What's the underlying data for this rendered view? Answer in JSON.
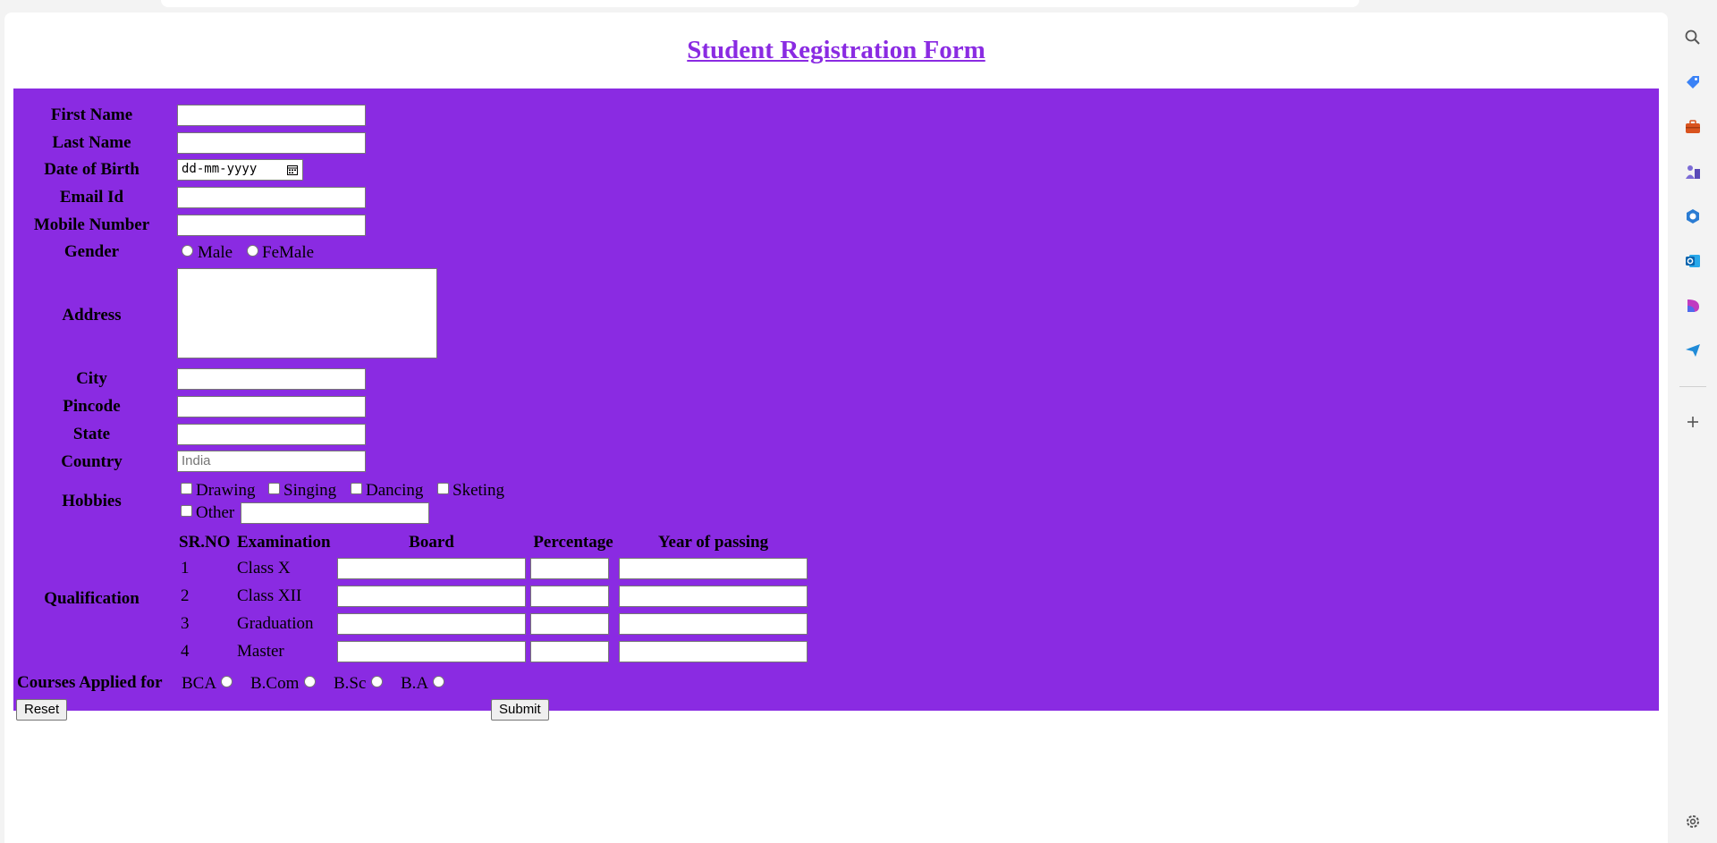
{
  "page": {
    "title": "Student Registration Form"
  },
  "form": {
    "first_name_label": "First Name",
    "last_name_label": "Last Name",
    "dob_label": "Date of Birth",
    "dob_placeholder": "dd-mm-yyyy",
    "email_label": "Email Id",
    "mobile_label": "Mobile Number",
    "gender_label": "Gender",
    "gender_options": [
      "Male",
      "FeMale"
    ],
    "address_label": "Address",
    "city_label": "City",
    "pincode_label": "Pincode",
    "state_label": "State",
    "country_label": "Country",
    "country_placeholder": "India",
    "hobbies_label": "Hobbies",
    "hobbies": [
      "Drawing",
      "Singing",
      "Dancing",
      "Sketing",
      "Other"
    ],
    "qualification_label": "Qualification",
    "qual_headers": [
      "SR.NO",
      "Examination",
      "Board",
      "Percentage",
      "Year of passing"
    ],
    "qual_rows": [
      {
        "sr": "1",
        "exam": "Class X"
      },
      {
        "sr": "2",
        "exam": "Class XII"
      },
      {
        "sr": "3",
        "exam": "Graduation"
      },
      {
        "sr": "4",
        "exam": "Master"
      }
    ],
    "courses_label": "Courses Applied for",
    "courses": [
      "BCA",
      "B.Com",
      "B.Sc",
      "B.A"
    ],
    "reset_label": "Reset",
    "submit_label": "Submit"
  },
  "colors": {
    "form_bg": "#8a2be2",
    "title": "#8a2be2"
  },
  "sidebar": {
    "icons": [
      "search-icon",
      "tag-icon",
      "briefcase-icon",
      "chess-icon",
      "copilot-icon",
      "outlook-icon",
      "designer-icon",
      "send-icon",
      "plus-icon",
      "settings-icon"
    ]
  }
}
